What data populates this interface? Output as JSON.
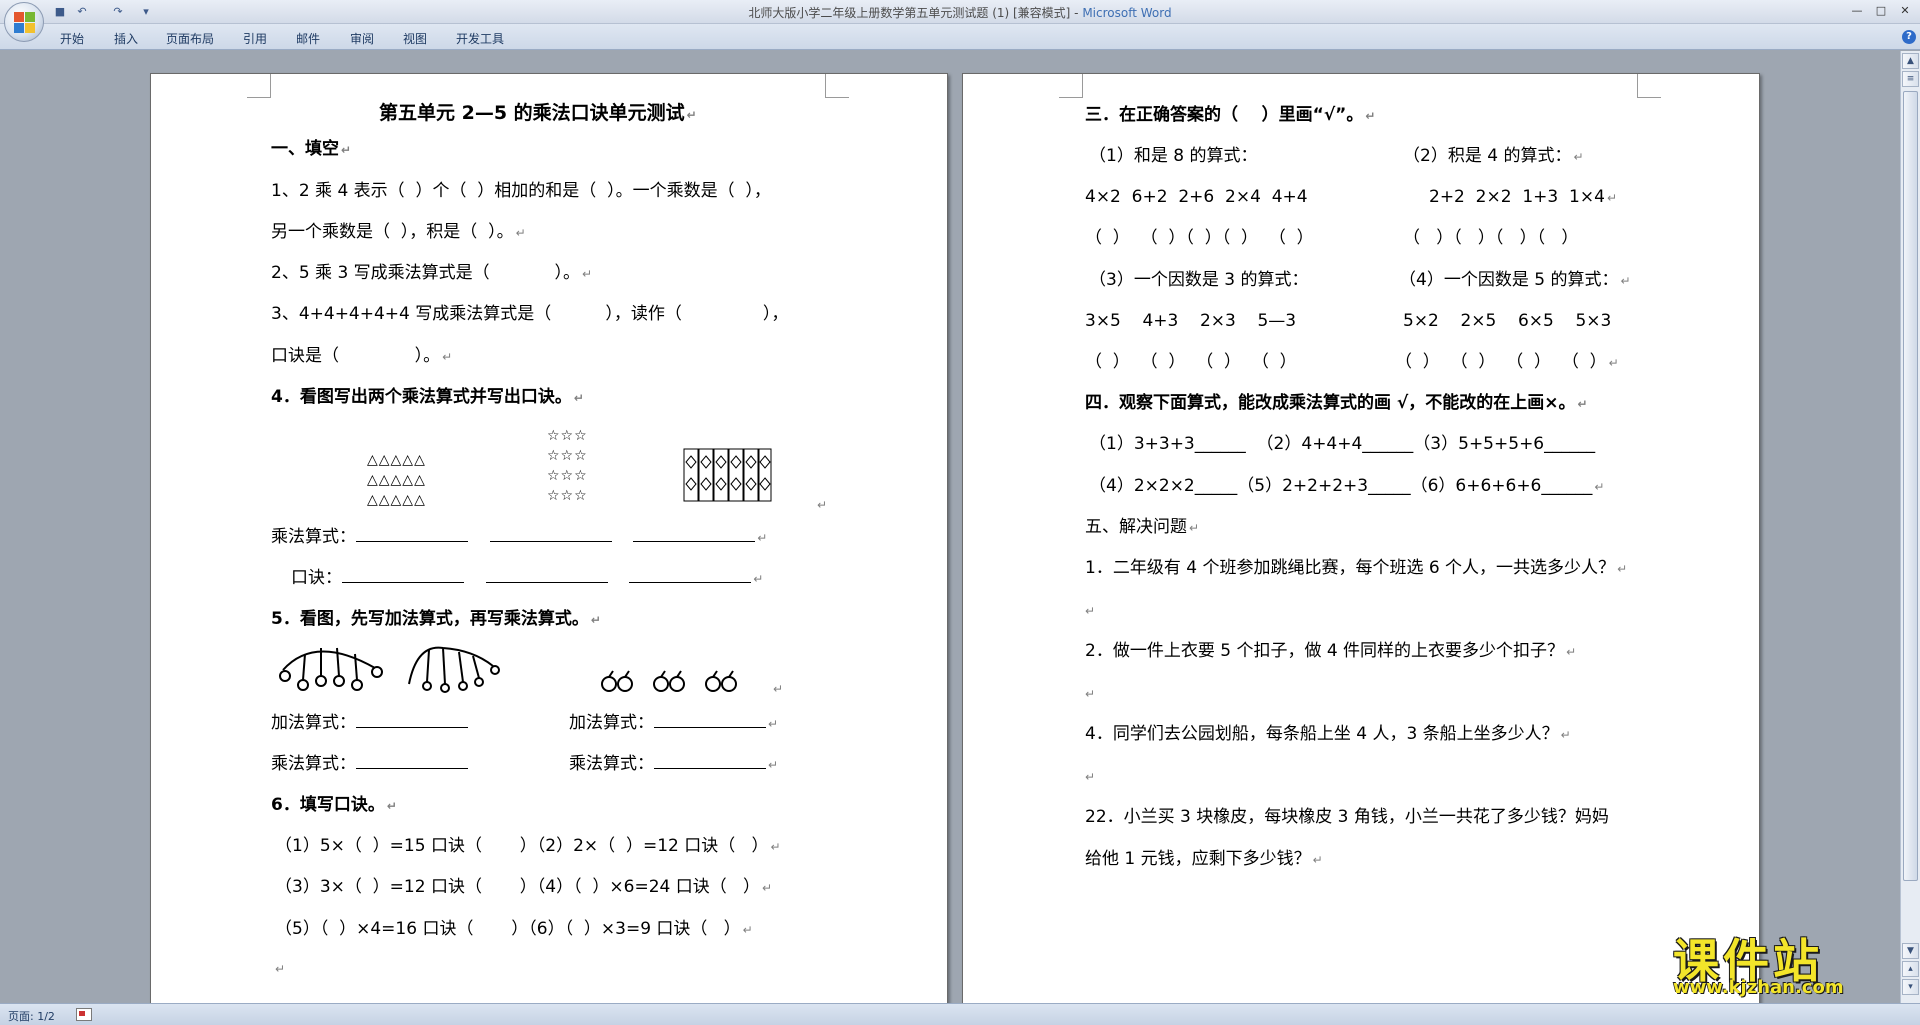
{
  "window": {
    "doc_title": "北师大版小学二年级上册数学第五单元测试题 (1) [兼容模式] - ",
    "app_name": "Microsoft Word",
    "minimize": "—",
    "maximize": "□",
    "close": "✕"
  },
  "quick_access": {
    "save": "■",
    "undo": "↶",
    "redo": "↷",
    "customize": "▾"
  },
  "ribbon": {
    "tabs": [
      "开始",
      "插入",
      "页面布局",
      "引用",
      "邮件",
      "审阅",
      "视图",
      "开发工具"
    ],
    "help": "?"
  },
  "page1": {
    "title": "第五单元 2—5 的乘法口诀单元测试",
    "s1_heading": "一、填空",
    "q1_a": "1、2 乘 4 表示（  ）个（  ）相加的和是（  ）。一个乘数是（  ），",
    "q1_b": "另一个乘数是（  ），积是（  ）。",
    "q2": "2、5 乘 3 写成乘法算式是（            ）。",
    "q3_a": "3、4+4+4+4+4 写成乘法算式是（          ），读作（               ），",
    "q3_b": "口诀是（              ）。",
    "q4": "4．看图写出两个乘法算式并写出口诀。",
    "fig_triangles": "△△△△△\n△△△△△\n△△△△△",
    "fig_stars": "☆☆☆\n☆☆☆\n☆☆☆\n☆☆☆\n",
    "row_mul_label": "乘法算式：",
    "row_koujue_label": "口诀：",
    "q5": "5．看图，先写加法算式，再写乘法算式。",
    "add_label_1": "加法算式：",
    "add_label_2": "加法算式：",
    "mul_label_1": "乘法算式：",
    "mul_label_2": "乘法算式：",
    "q6": "6．填写口诀。",
    "q6_1": "（1）5×（  ）=15 口诀（       ）（2）2×（  ）=12 口诀（   ）",
    "q6_2": "（3）3×（  ）=12 口诀（       ）（4）（  ）×6=24 口诀（   ）",
    "q6_3": "（5）（  ）×4=16 口诀（       ）（6）（  ）×3=9 口诀（   ）"
  },
  "page2": {
    "s3_heading": "三．在正确答案的（    ）里画“√”。",
    "p1_label": "（1）和是 8 的算式：",
    "p2_label": "（2）积是 4 的算式：",
    "p1_exprs": "4×2  6+2  2+6  2×4  4+4",
    "p2_exprs": "2+2  2×2  1+3  1×4",
    "p1_paren": "（  ）  （  ）（  ）（  ）  （  ）",
    "p2_paren": "（   ）（   ）（   ）（   ）",
    "p3_label": "（3）一个因数是 3 的算式：",
    "p4_label": "（4）一个因数是 5 的算式：",
    "p3_exprs": "3×5    4+3    2×3    5—3",
    "p4_exprs": "5×2    2×5    6×5    5×3",
    "p3_paren": "（  ）  （  ）  （  ）  （  ）",
    "p4_paren": "（  ）  （  ）  （  ）  （  ）",
    "s4_heading": "四．观察下面算式，能改成乘法算式的画 √，不能改的在上画×。",
    "s4_row1": "（1）3+3+3______  （2）4+4+4______（3）5+5+5+6______",
    "s4_row2": "（4）2×2×2_____（5）2+2+2+3_____（6）6+6+6+6______",
    "s5_heading": "五、解决问题",
    "w1": "1．二年级有 4 个班参加跳绳比赛，每个班选 6 个人，一共选多少人？",
    "w2": "2．做一件上衣要 5 个扣子，做 4 件同样的上衣要多少个扣子？",
    "w3": "4．同学们去公园划船，每条船上坐 4 人，3 条船上坐多少人？",
    "w4_a": "22．小兰买 3 块橡皮，每块橡皮 3 角钱，小兰一共花了多少钱？妈妈",
    "w4_b": "给他 1 元钱，应剩下多少钱？"
  },
  "paragraph_mark": "↵",
  "status": {
    "page_indicator": "页面: 1/2"
  },
  "watermark": {
    "title": "课件站",
    "url": "www.kjzhan.com"
  }
}
